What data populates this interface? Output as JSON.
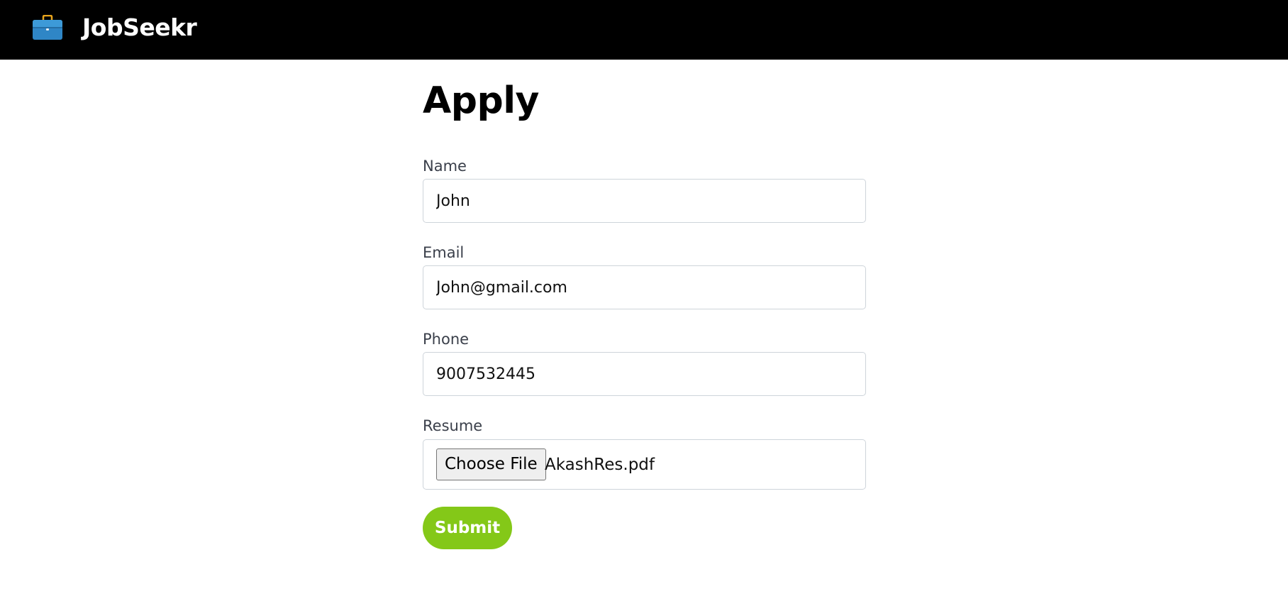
{
  "header": {
    "brand": "JobSeekr",
    "icon": "briefcase-icon"
  },
  "page": {
    "title": "Apply"
  },
  "form": {
    "name": {
      "label": "Name",
      "value": "John"
    },
    "email": {
      "label": "Email",
      "value": "John@gmail.com"
    },
    "phone": {
      "label": "Phone",
      "value": "9007532445"
    },
    "resume": {
      "label": "Resume",
      "button_label": "Choose File",
      "file_name": "AkashRes.pdf"
    },
    "submit_label": "Submit"
  },
  "colors": {
    "navbar": "#000000",
    "submit": "#84c818",
    "briefcase": "#2f86c6"
  }
}
